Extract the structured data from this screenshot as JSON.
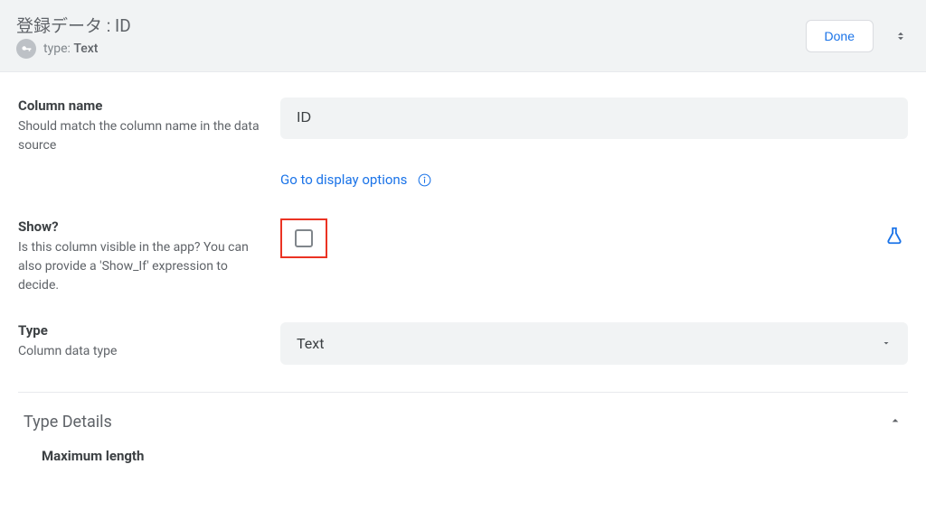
{
  "header": {
    "title": "登録データ : ID",
    "type_prefix": "type:",
    "type_value": "Text",
    "done_label": "Done"
  },
  "fields": {
    "column_name": {
      "label": "Column name",
      "desc": "Should match the column name in the data source",
      "value": "ID"
    },
    "display_link": "Go to display options",
    "show": {
      "label": "Show?",
      "desc": "Is this column visible in the app? You can also provide a 'Show_If' expression to decide."
    },
    "type": {
      "label": "Type",
      "desc": "Column data type",
      "value": "Text"
    }
  },
  "sections": {
    "type_details": {
      "title": "Type Details",
      "max_length_label": "Maximum length"
    }
  }
}
